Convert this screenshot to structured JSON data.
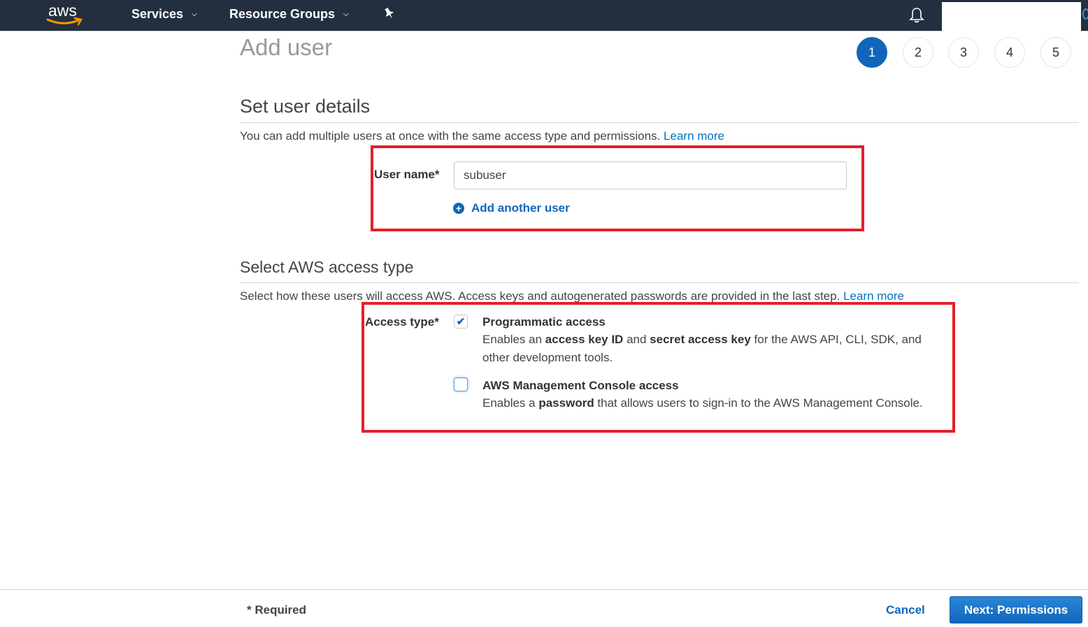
{
  "topnav": {
    "logo_text": "aws",
    "services_label": "Services",
    "resource_groups_label": "Resource Groups",
    "pin_icon": "pushpin-icon",
    "bell_icon": "bell-icon",
    "account_label": ""
  },
  "page": {
    "title": "Add user",
    "steps": [
      "1",
      "2",
      "3",
      "4",
      "5"
    ],
    "active_step": 1
  },
  "user_details": {
    "heading": "Set user details",
    "description": "You can add multiple users at once with the same access type and permissions.",
    "learn_more": "Learn more",
    "username_label": "User name*",
    "username_value": "subuser",
    "add_another_user": "Add another user"
  },
  "access_type": {
    "heading": "Select AWS access type",
    "description": "Select how these users will access AWS. Access keys and autogenerated passwords are provided in the last step.",
    "learn_more": "Learn more",
    "label": "Access type*",
    "options": [
      {
        "title": "Programmatic access",
        "checked": true,
        "desc_parts": [
          "Enables an ",
          "access key ID",
          " and ",
          "secret access key",
          " for the AWS API, CLI, SDK, and other development tools."
        ]
      },
      {
        "title": "AWS Management Console access",
        "checked": false,
        "desc_parts": [
          "Enables a ",
          "password",
          " that allows users to sign-in to the AWS Management Console."
        ]
      }
    ]
  },
  "footer": {
    "required_note": "* Required",
    "cancel_label": "Cancel",
    "next_label": "Next: Permissions"
  },
  "colors": {
    "nav_bg": "#232f3e",
    "accent": "#1166bb",
    "highlight_box": "#e3202a",
    "logo_smile": "#ff9900"
  }
}
